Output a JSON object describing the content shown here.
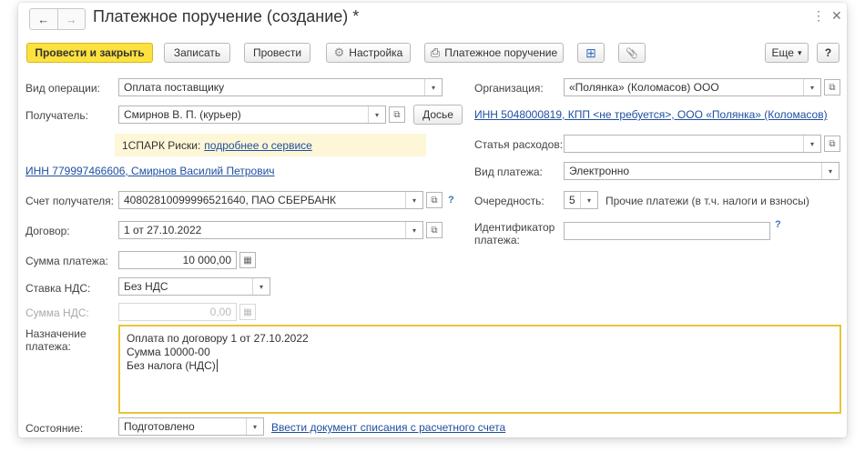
{
  "window": {
    "title": "Платежное поручение (создание) *"
  },
  "nav": {
    "back": "←",
    "forward": "→"
  },
  "titlebar": {
    "more": "⋮",
    "close": "✕"
  },
  "toolbar": {
    "post_close": "Провести и закрыть",
    "save": "Записать",
    "post": "Провести",
    "settings": "Настройка",
    "print": "Платежное поручение",
    "more": "Еще",
    "help": "?"
  },
  "left": {
    "op_type_label": "Вид операции:",
    "op_type_value": "Оплата поставщику",
    "recipient_label": "Получатель:",
    "recipient_value": "Смирнов В. П. (курьер)",
    "dossier_button": "Досье",
    "spark_text": "1СПАРК Риски:",
    "spark_link": "подробнее о сервисе",
    "inn_link": "ИНН 779997466606, Смирнов Василий Петрович",
    "account_label": "Счет получателя:",
    "account_value": "40802810099996521640, ПАО СБЕРБАНК",
    "contract_label": "Договор:",
    "contract_value": "1 от 27.10.2022",
    "sum_label": "Сумма платежа:",
    "sum_value": "10 000,00",
    "vat_rate_label": "Ставка НДС:",
    "vat_rate_value": "Без НДС",
    "vat_sum_label": "Сумма НДС:",
    "vat_sum_value": "0,00",
    "purpose_label_1": "Назначение",
    "purpose_label_2": "платежа:",
    "purpose_lines": [
      "Оплата по договору 1 от 27.10.2022",
      "Сумма 10000-00",
      "Без налога (НДС)"
    ],
    "state_label": "Состояние:",
    "state_value": "Подготовлено",
    "state_link": "Ввести документ списания с расчетного счета"
  },
  "right": {
    "org_label": "Организация:",
    "org_value": "«Полянка» (Коломасов) ООО",
    "org_inn_link": "ИНН 5048000819, КПП <не требуется>, ООО «Полянка» (Коломасов)",
    "expense_label": "Статья расходов:",
    "expense_value": "",
    "payment_type_label": "Вид платежа:",
    "payment_type_value": "Электронно",
    "priority_label": "Очередность:",
    "priority_value": "5",
    "priority_desc": "Прочие платежи (в т.ч. налоги и взносы)",
    "payment_id_label_1": "Идентификатор",
    "payment_id_label_2": "платежа:",
    "payment_id_value": ""
  },
  "icons": {
    "dropdown": "▾",
    "open": "⧉",
    "calc": "▦",
    "question": "?",
    "gear": "⚙",
    "printer": "⎙",
    "paperclip": "📎",
    "structure": "⊞"
  }
}
